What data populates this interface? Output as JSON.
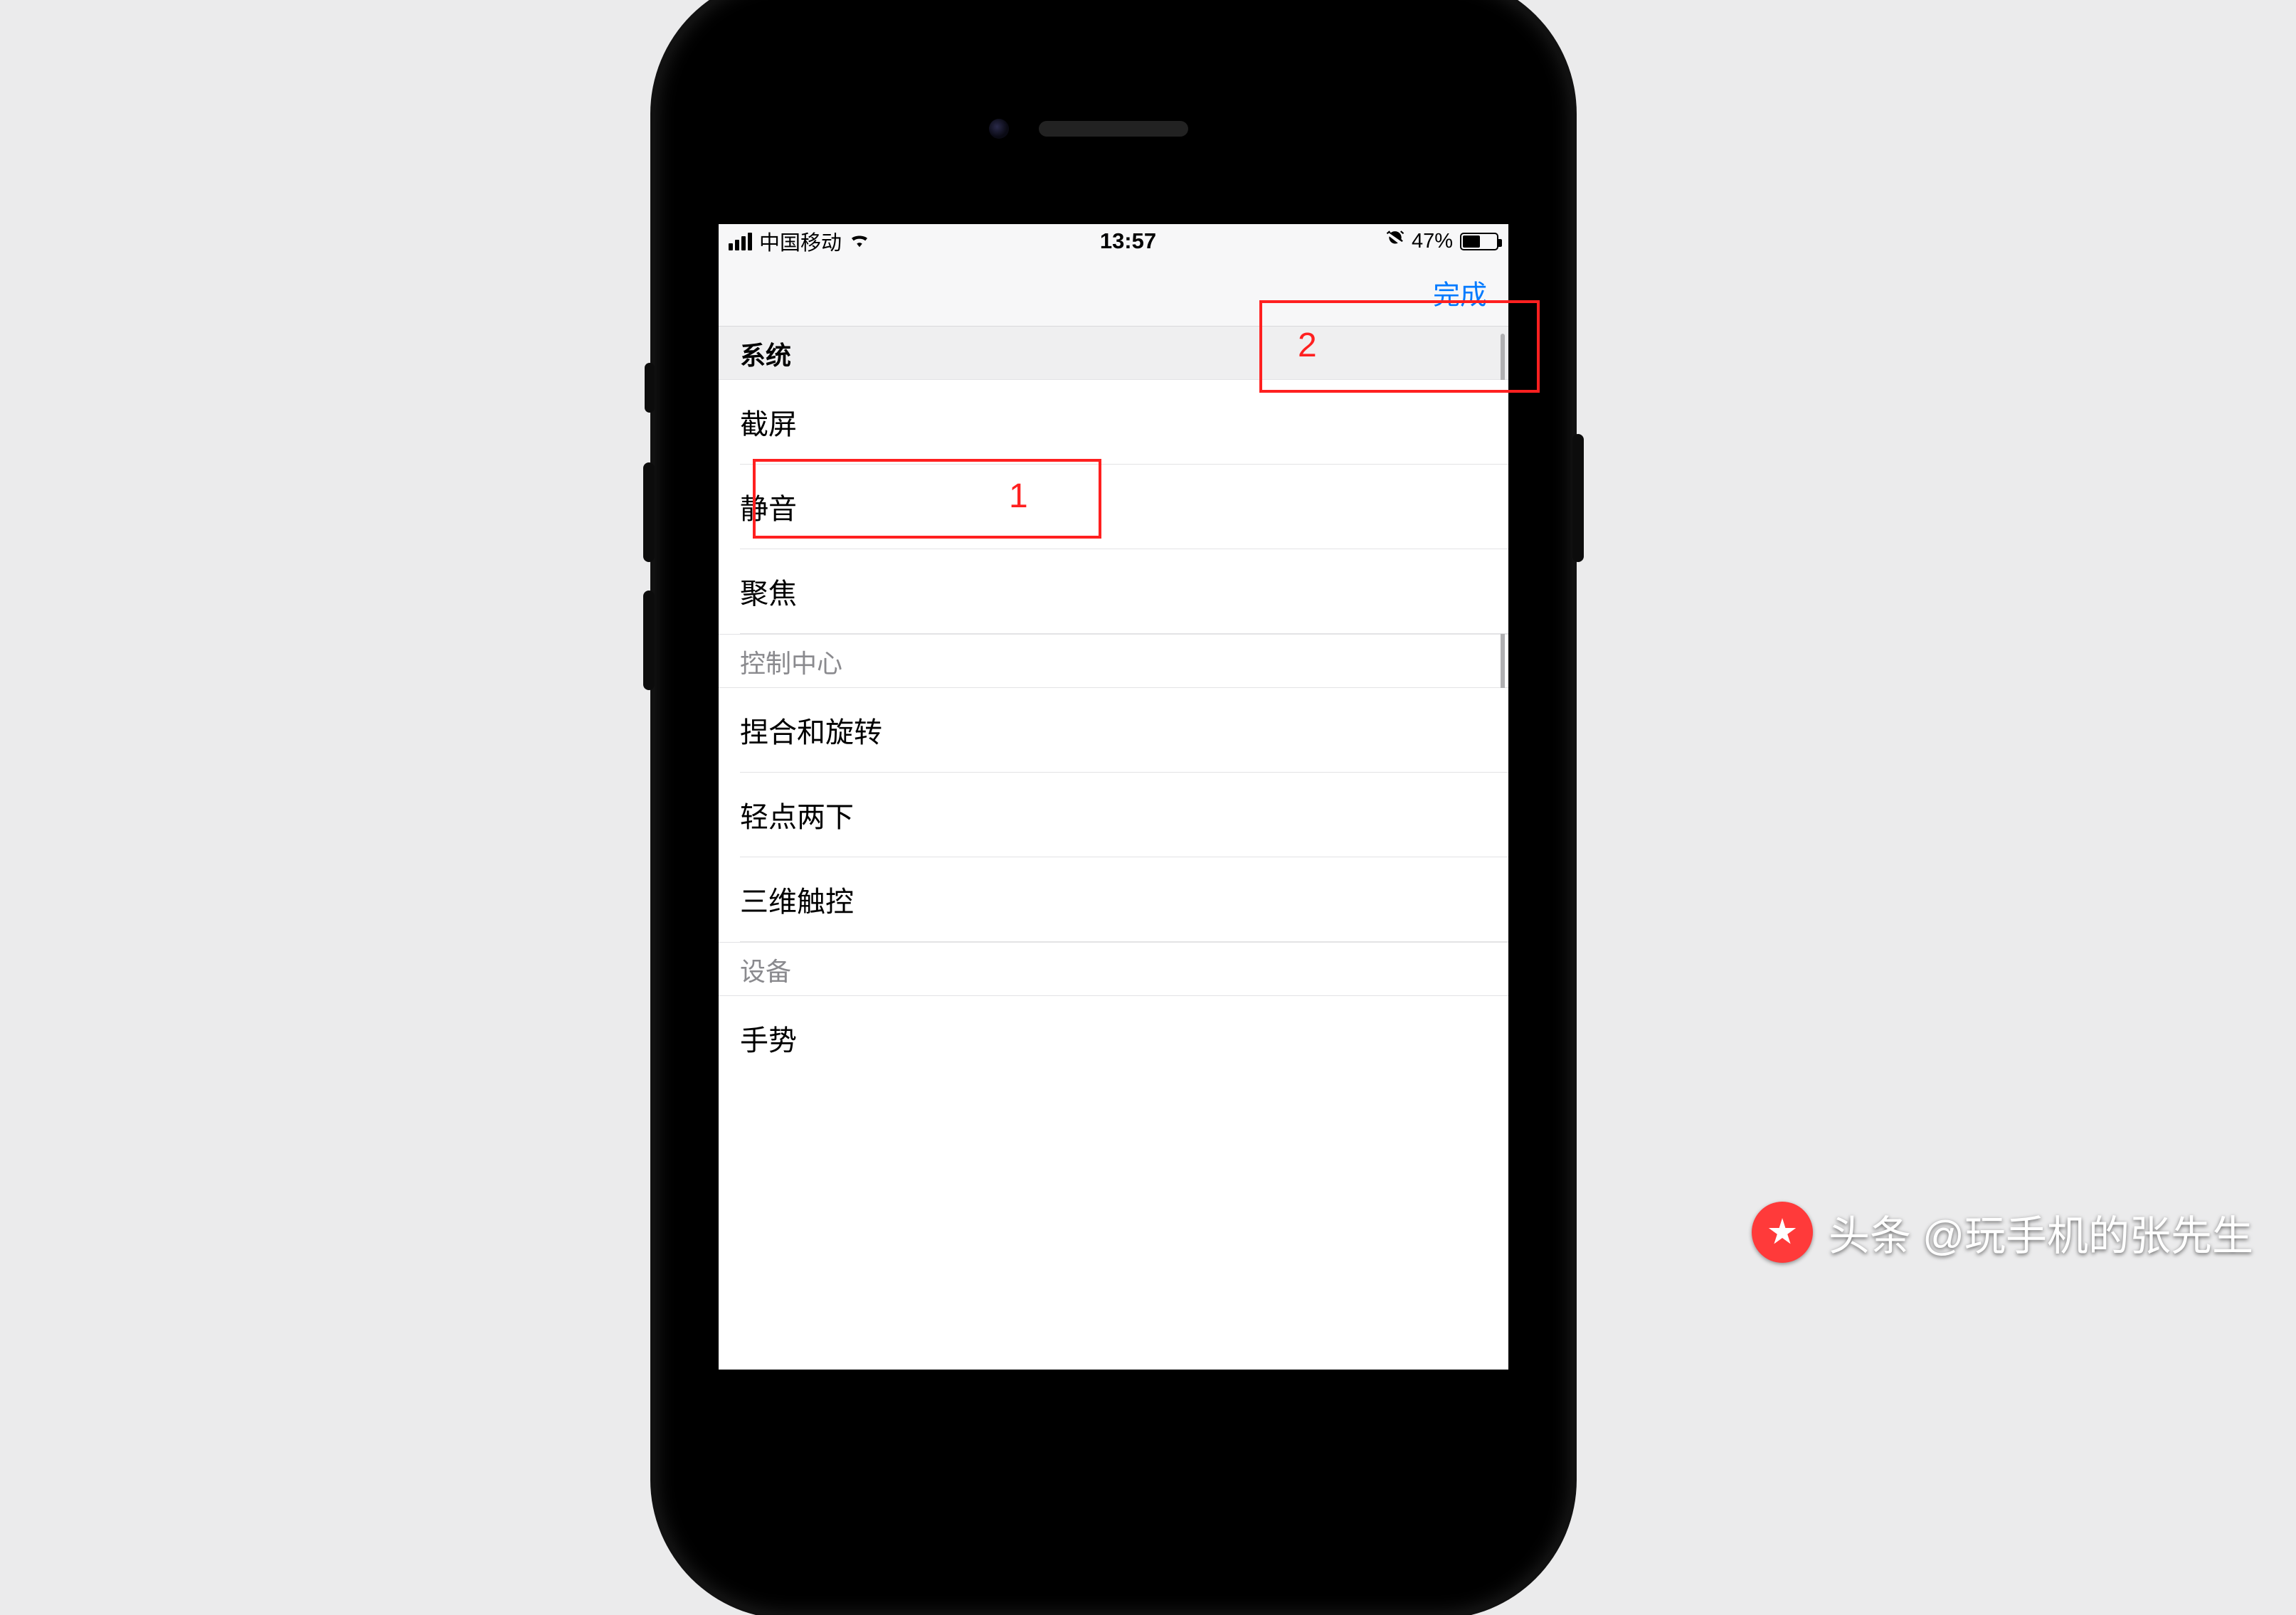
{
  "status": {
    "carrier": "中国移动",
    "time": "13:57",
    "battery_pct": "47%"
  },
  "nav": {
    "done_label": "完成"
  },
  "sections": {
    "system_header": "系统",
    "screenshot": "截屏",
    "mute": "静音",
    "focus": "聚焦",
    "control_center_header": "控制中心",
    "pinch_rotate": "捏合和旋转",
    "double_tap": "轻点两下",
    "threed_touch": "三维触控",
    "device_header": "设备",
    "gestures": "手势"
  },
  "annotations": {
    "label1": "1",
    "label2": "2"
  },
  "watermark": {
    "text": "头条 @玩手机的张先生"
  }
}
